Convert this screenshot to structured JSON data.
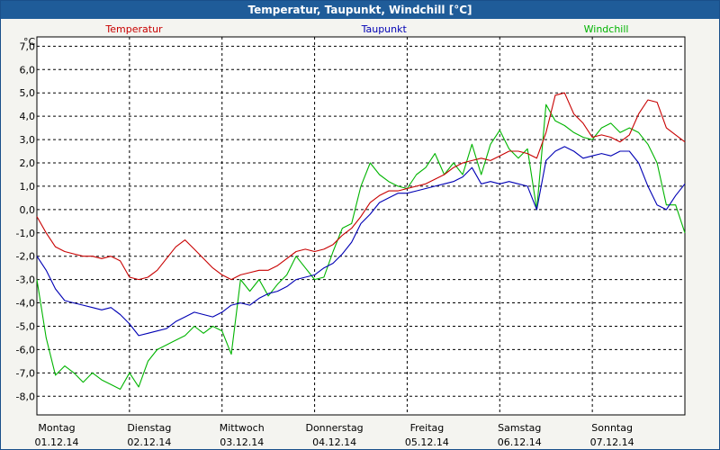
{
  "window": {
    "title": "Temperatur, Taupunkt, Windchill [°C]"
  },
  "chart_data": {
    "type": "line",
    "title": "Temperatur, Taupunkt, Windchill [°C]",
    "ylabel": "°C",
    "xlabel": "",
    "ylim": [
      -8.8,
      7.4
    ],
    "yticks": [
      -8,
      -7,
      -6,
      -5,
      -4,
      -3,
      -2,
      -1,
      0,
      1,
      2,
      3,
      4,
      5,
      6,
      7
    ],
    "ytick_labels": [
      "-8,0",
      "-7,0",
      "-6,0",
      "-5,0",
      "-4,0",
      "-3,0",
      "-2,0",
      "-1,0",
      "0,0",
      "1,0",
      "2,0",
      "3,0",
      "4,0",
      "5,0",
      "6,0",
      "7,0"
    ],
    "xlim": [
      0,
      7
    ],
    "x_unit": "days since 01.12.14 00:00",
    "days": [
      {
        "weekday": "Montag",
        "date": "01.12.14"
      },
      {
        "weekday": "Dienstag",
        "date": "02.12.14"
      },
      {
        "weekday": "Mittwoch",
        "date": "03.12.14"
      },
      {
        "weekday": "Donnerstag",
        "date": "04.12.14"
      },
      {
        "weekday": "Freitag",
        "date": "05.12.14"
      },
      {
        "weekday": "Samstag",
        "date": "06.12.14"
      },
      {
        "weekday": "Sonntag",
        "date": "07.12.14"
      }
    ],
    "grid": true,
    "legend_position": "top",
    "series": [
      {
        "name": "Temperatur",
        "color": "#c80000",
        "x": [
          0,
          0.1,
          0.2,
          0.3,
          0.4,
          0.5,
          0.6,
          0.7,
          0.8,
          0.9,
          1.0,
          1.1,
          1.2,
          1.3,
          1.4,
          1.5,
          1.6,
          1.7,
          1.8,
          1.9,
          2.0,
          2.1,
          2.2,
          2.3,
          2.4,
          2.5,
          2.6,
          2.7,
          2.8,
          2.9,
          3.0,
          3.1,
          3.2,
          3.3,
          3.4,
          3.5,
          3.6,
          3.7,
          3.8,
          3.9,
          4.0,
          4.1,
          4.2,
          4.3,
          4.4,
          4.5,
          4.6,
          4.7,
          4.8,
          4.9,
          5.0,
          5.1,
          5.2,
          5.3,
          5.4,
          5.5,
          5.6,
          5.7,
          5.8,
          5.9,
          6.0,
          6.1,
          6.2,
          6.3,
          6.4,
          6.5,
          6.6,
          6.7,
          6.8,
          6.9,
          7.0
        ],
        "y": [
          -0.3,
          -1.0,
          -1.6,
          -1.8,
          -1.9,
          -2.0,
          -2.0,
          -2.1,
          -2.0,
          -2.2,
          -2.9,
          -3.0,
          -2.9,
          -2.6,
          -2.1,
          -1.6,
          -1.3,
          -1.7,
          -2.1,
          -2.5,
          -2.8,
          -3.0,
          -2.8,
          -2.7,
          -2.6,
          -2.6,
          -2.4,
          -2.1,
          -1.8,
          -1.7,
          -1.8,
          -1.7,
          -1.5,
          -1.1,
          -0.8,
          -0.3,
          0.3,
          0.6,
          0.8,
          0.8,
          0.9,
          1.0,
          1.1,
          1.3,
          1.5,
          1.8,
          2.0,
          2.1,
          2.2,
          2.1,
          2.3,
          2.5,
          2.5,
          2.4,
          2.2,
          3.3,
          4.9,
          5.0,
          4.1,
          3.7,
          3.1,
          3.2,
          3.1,
          2.9,
          3.2,
          4.1,
          4.7,
          4.6,
          3.5,
          3.2,
          2.9
        ]
      },
      {
        "name": "Taupunkt",
        "color": "#0000b4",
        "x": [
          0,
          0.1,
          0.2,
          0.3,
          0.4,
          0.5,
          0.6,
          0.7,
          0.8,
          0.9,
          1.0,
          1.1,
          1.2,
          1.3,
          1.4,
          1.5,
          1.6,
          1.7,
          1.8,
          1.9,
          2.0,
          2.1,
          2.2,
          2.3,
          2.4,
          2.5,
          2.6,
          2.7,
          2.8,
          2.9,
          3.0,
          3.1,
          3.2,
          3.3,
          3.4,
          3.5,
          3.6,
          3.7,
          3.8,
          3.9,
          4.0,
          4.1,
          4.2,
          4.3,
          4.4,
          4.5,
          4.6,
          4.7,
          4.8,
          4.9,
          5.0,
          5.1,
          5.2,
          5.3,
          5.4,
          5.5,
          5.6,
          5.7,
          5.8,
          5.9,
          6.0,
          6.1,
          6.2,
          6.3,
          6.4,
          6.5,
          6.6,
          6.7,
          6.8,
          6.9,
          7.0
        ],
        "y": [
          -2.0,
          -2.6,
          -3.4,
          -3.9,
          -4.0,
          -4.1,
          -4.2,
          -4.3,
          -4.2,
          -4.5,
          -4.9,
          -5.4,
          -5.3,
          -5.2,
          -5.1,
          -4.8,
          -4.6,
          -4.4,
          -4.5,
          -4.6,
          -4.4,
          -4.1,
          -4.0,
          -4.1,
          -3.8,
          -3.6,
          -3.5,
          -3.3,
          -3.0,
          -2.9,
          -2.8,
          -2.5,
          -2.3,
          -1.9,
          -1.4,
          -0.6,
          -0.2,
          0.3,
          0.5,
          0.7,
          0.7,
          0.8,
          0.9,
          1.0,
          1.1,
          1.2,
          1.4,
          1.8,
          1.1,
          1.2,
          1.1,
          1.2,
          1.1,
          1.0,
          0.0,
          2.1,
          2.5,
          2.7,
          2.5,
          2.2,
          2.3,
          2.4,
          2.3,
          2.5,
          2.5,
          2.0,
          1.0,
          0.2,
          0.0,
          0.6,
          1.1
        ]
      },
      {
        "name": "Windchill",
        "color": "#00b400",
        "x": [
          0,
          0.1,
          0.2,
          0.3,
          0.4,
          0.5,
          0.6,
          0.7,
          0.8,
          0.9,
          1.0,
          1.1,
          1.2,
          1.3,
          1.4,
          1.5,
          1.6,
          1.7,
          1.8,
          1.9,
          2.0,
          2.1,
          2.2,
          2.3,
          2.4,
          2.5,
          2.6,
          2.7,
          2.8,
          2.9,
          3.0,
          3.1,
          3.2,
          3.3,
          3.4,
          3.5,
          3.6,
          3.7,
          3.8,
          3.9,
          4.0,
          4.1,
          4.2,
          4.3,
          4.4,
          4.5,
          4.6,
          4.7,
          4.8,
          4.9,
          5.0,
          5.1,
          5.2,
          5.3,
          5.4,
          5.5,
          5.6,
          5.7,
          5.8,
          5.9,
          6.0,
          6.1,
          6.2,
          6.3,
          6.4,
          6.5,
          6.6,
          6.7,
          6.8,
          6.9,
          7.0
        ],
        "y": [
          -3.0,
          -5.5,
          -7.1,
          -6.7,
          -7.0,
          -7.4,
          -7.0,
          -7.3,
          -7.5,
          -7.7,
          -7.0,
          -7.6,
          -6.5,
          -6.0,
          -5.8,
          -5.6,
          -5.4,
          -5.0,
          -5.3,
          -5.0,
          -5.2,
          -6.2,
          -3.0,
          -3.5,
          -3.0,
          -3.7,
          -3.2,
          -2.8,
          -2.0,
          -2.5,
          -3.0,
          -2.9,
          -1.8,
          -0.8,
          -0.6,
          1.0,
          2.0,
          1.5,
          1.2,
          1.0,
          0.9,
          1.5,
          1.8,
          2.4,
          1.5,
          2.0,
          1.5,
          2.8,
          1.5,
          2.8,
          3.4,
          2.6,
          2.2,
          2.6,
          0.0,
          4.5,
          3.8,
          3.6,
          3.3,
          3.1,
          3.0,
          3.5,
          3.7,
          3.3,
          3.5,
          3.3,
          2.8,
          2.0,
          0.2,
          0.2,
          -1.0
        ]
      }
    ]
  }
}
